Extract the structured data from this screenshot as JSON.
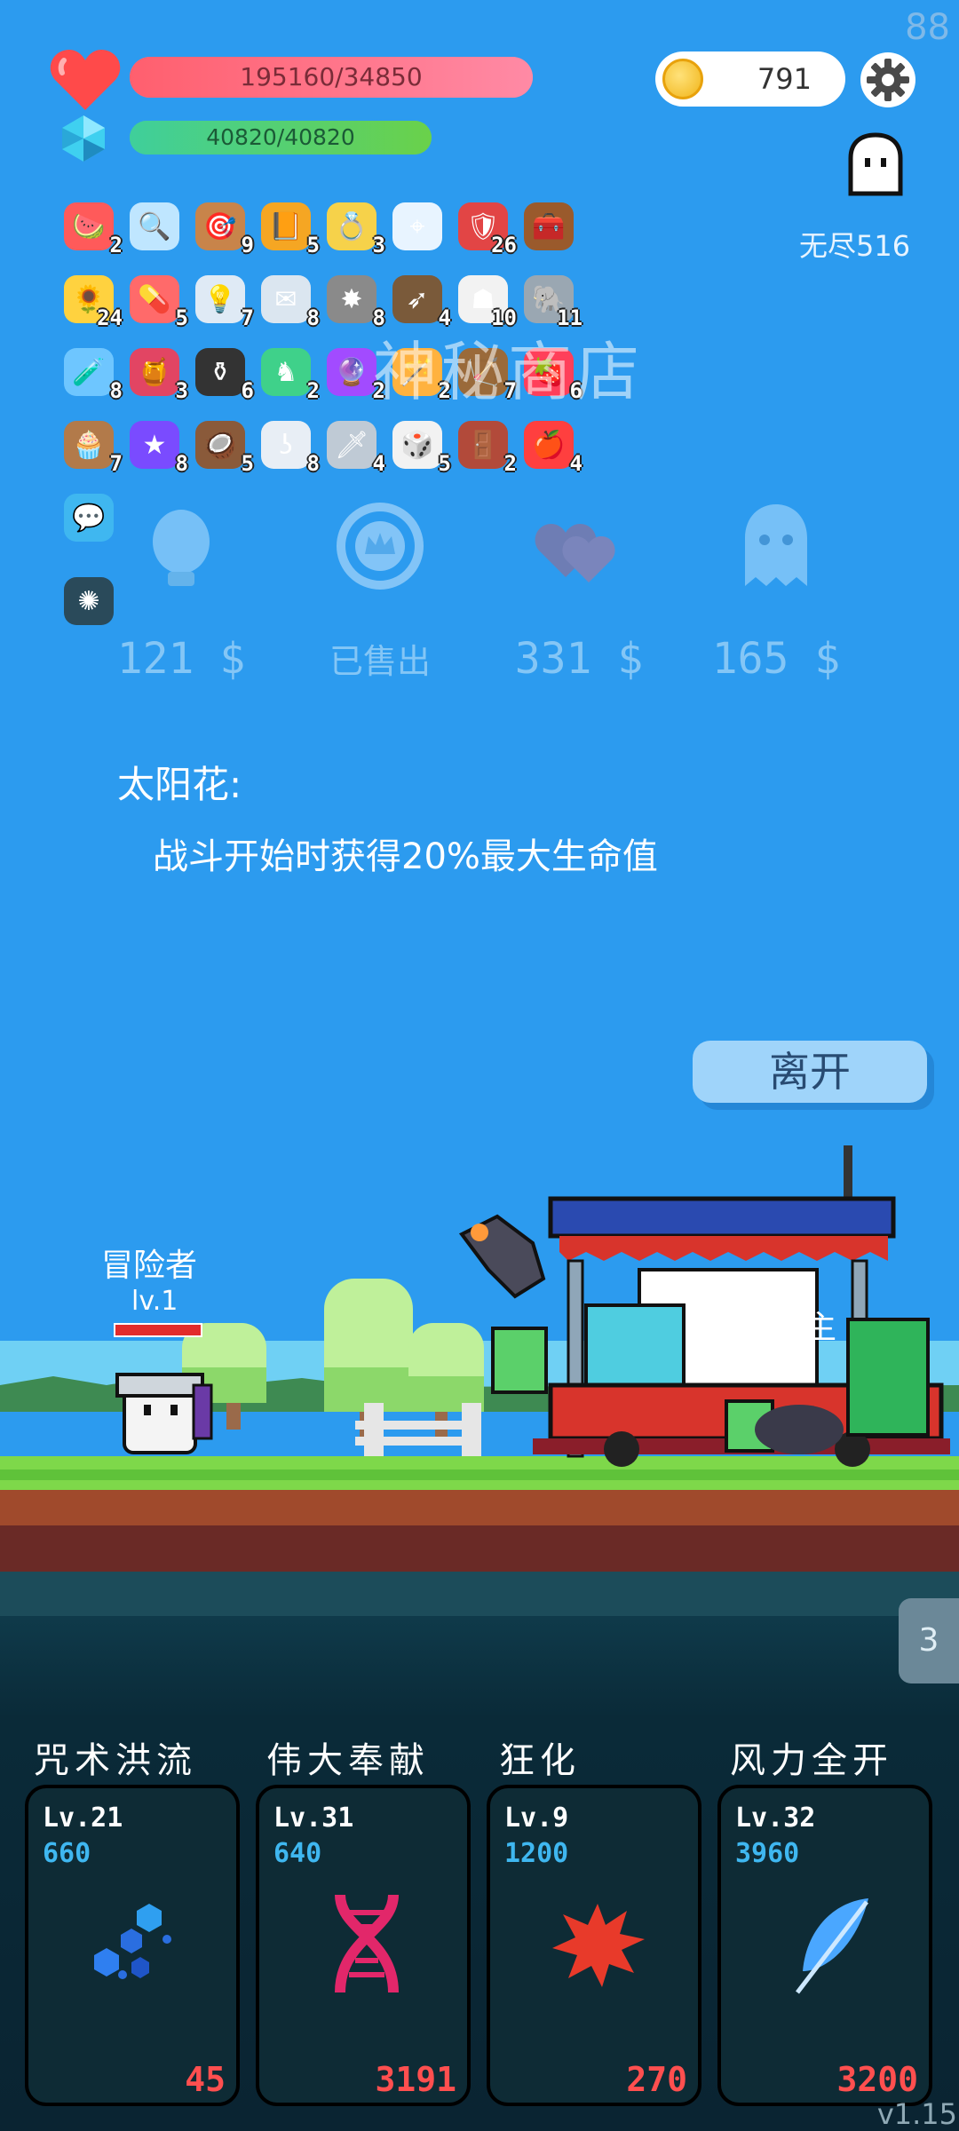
{
  "fps": "88",
  "player": {
    "hp_text": "195160/34850",
    "hp_fraction": 1.0,
    "mp_text": "40820/40820",
    "mp_fraction": 1.0
  },
  "currency": {
    "coins": "791"
  },
  "mode": {
    "label": "无尽516"
  },
  "items": [
    {
      "icon": "watermelon-icon",
      "glyph": "🍉",
      "count": "2",
      "bg": "#ff5a5a"
    },
    {
      "icon": "magnifier-icon",
      "glyph": "🔍",
      "count": "",
      "bg": "#bfe6ff"
    },
    {
      "icon": "target-icon",
      "glyph": "🎯",
      "count": "9",
      "bg": "#c8844a"
    },
    {
      "icon": "book-icon",
      "glyph": "📙",
      "count": "5",
      "bg": "#f5a623"
    },
    {
      "icon": "ring-icon",
      "glyph": "💍",
      "count": "3",
      "bg": "#f6d24a"
    },
    {
      "icon": "crosshair-icon",
      "glyph": "⌖",
      "count": "",
      "bg": "#e8f4ff"
    },
    {
      "icon": "shield-icon",
      "glyph": "🛡",
      "count": "26",
      "bg": "#e24545"
    },
    {
      "icon": "chest-icon",
      "glyph": "🧰",
      "count": "",
      "bg": "#9a5a2c"
    },
    {
      "icon": "sunflower-icon",
      "glyph": "🌻",
      "count": "24",
      "bg": "#ffd23f"
    },
    {
      "icon": "pill-icon",
      "glyph": "💊",
      "count": "5",
      "bg": "#ff6a6a"
    },
    {
      "icon": "bulb-icon",
      "glyph": "💡",
      "count": "7",
      "bg": "#dfeaf5"
    },
    {
      "icon": "letter-icon",
      "glyph": "✉",
      "count": "8",
      "bg": "#dbe6f0"
    },
    {
      "icon": "spike-icon",
      "glyph": "✸",
      "count": "8",
      "bg": "#8a8a8a"
    },
    {
      "icon": "arrows-icon",
      "glyph": "➶",
      "count": "4",
      "bg": "#7a5a3a"
    },
    {
      "icon": "ghost-cow-icon",
      "glyph": "☗",
      "count": "10",
      "bg": "#f2f2f2"
    },
    {
      "icon": "elephant-icon",
      "glyph": "🐘",
      "count": "11",
      "bg": "#9aa7b2"
    },
    {
      "icon": "potion-icon",
      "glyph": "🧪",
      "count": "8",
      "bg": "#6ec6ff"
    },
    {
      "icon": "jam-icon",
      "glyph": "🍯",
      "count": "3",
      "bg": "#e24563"
    },
    {
      "icon": "cauldron-icon",
      "glyph": "⚱",
      "count": "6",
      "bg": "#333"
    },
    {
      "icon": "statue-icon",
      "glyph": "♞",
      "count": "2",
      "bg": "#3fd18a"
    },
    {
      "icon": "orb-icon",
      "glyph": "🔮",
      "count": "2",
      "bg": "#a24bff"
    },
    {
      "icon": "wand-icon",
      "glyph": "🪄",
      "count": "2",
      "bg": "#ffb23f"
    },
    {
      "icon": "bow-icon",
      "glyph": "🏹",
      "count": "7",
      "bg": "#9a6a3a"
    },
    {
      "icon": "strawberry-icon",
      "glyph": "🍓",
      "count": "6",
      "bg": "#ff3f5a"
    },
    {
      "icon": "cake-icon",
      "glyph": "🧁",
      "count": "7",
      "bg": "#b27a4a"
    },
    {
      "icon": "magic-box-icon",
      "glyph": "★",
      "count": "8",
      "bg": "#7a4bff"
    },
    {
      "icon": "coconut-icon",
      "glyph": "🥥",
      "count": "5",
      "bg": "#8a5a3a"
    },
    {
      "icon": "hook-icon",
      "glyph": "ʖ",
      "count": "8",
      "bg": "#e8eef5"
    },
    {
      "icon": "sword-icon",
      "glyph": "🗡",
      "count": "4",
      "bg": "#bfcad5"
    },
    {
      "icon": "dice-icon",
      "glyph": "🎲",
      "count": "5",
      "bg": "#f2f2f2"
    },
    {
      "icon": "door-icon",
      "glyph": "🚪",
      "count": "2",
      "bg": "#b24a3a"
    },
    {
      "icon": "apple-icon",
      "glyph": "🍎",
      "count": "4",
      "bg": "#ff3f3f"
    },
    {
      "icon": "chat-icon",
      "glyph": "💬",
      "count": "",
      "bg": "#3fb7f0"
    },
    {
      "icon": "lamp-frame-icon",
      "glyph": "✺",
      "count": "",
      "bg": "#2a4a5a"
    }
  ],
  "shop": {
    "title": "神秘商店",
    "offers": [
      {
        "icon": "bulb-ghost-icon",
        "price": "121 $",
        "sold": false
      },
      {
        "icon": "crown-badge-icon",
        "price": "已售出",
        "sold": true
      },
      {
        "icon": "hearts-icon",
        "price": "331 $",
        "sold": false
      },
      {
        "icon": "ghost-icon",
        "price": "165 $",
        "sold": false
      }
    ]
  },
  "description": {
    "title": "太阳花:",
    "text": "战斗开始时获得20%最大生命值"
  },
  "leave_button": "离开",
  "scene": {
    "adventurer_name": "冒险者",
    "adventurer_level": "lv.1",
    "adventurer_hp_fraction": 1.0,
    "keeper_name": "店主",
    "side_tab": "3"
  },
  "skills": [
    {
      "name": "咒术洪流",
      "level": "Lv.21",
      "cost": "660",
      "value": "45",
      "icon": "hex-bubbles-icon",
      "color": "#2f7ff0"
    },
    {
      "name": "伟大奉献",
      "level": "Lv.31",
      "cost": "640",
      "value": "3191",
      "icon": "dna-icon",
      "color": "#e2276a"
    },
    {
      "name": "狂化",
      "level": "Lv.9",
      "cost": "1200",
      "value": "270",
      "icon": "splat-icon",
      "color": "#e83a2a"
    },
    {
      "name": "风力全开",
      "level": "Lv.32",
      "cost": "3960",
      "value": "3200",
      "icon": "feather-icon",
      "color": "#4aa7ff"
    }
  ],
  "version": "v1.15"
}
